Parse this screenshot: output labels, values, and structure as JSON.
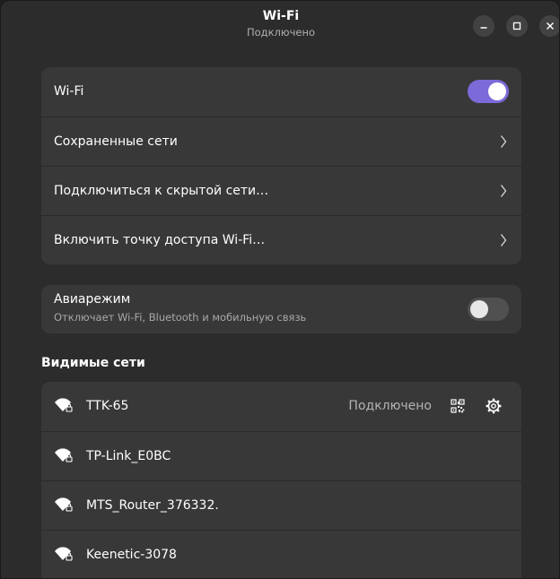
{
  "header": {
    "title": "Wi-Fi",
    "subtitle": "Подключено"
  },
  "wifi_card": {
    "wifi_label": "Wi-Fi",
    "wifi_enabled": true,
    "saved_networks": "Сохраненные сети",
    "hidden_network": "Подключиться к скрытой сети…",
    "hotspot": "Включить точку доступа Wi-Fi…"
  },
  "airplane": {
    "title": "Авиарежим",
    "subtitle": "Отключает Wi-Fi, Bluetooth и мобильную связь",
    "enabled": false
  },
  "visible_networks": {
    "heading": "Видимые сети",
    "networks": [
      {
        "name": "TTK-65",
        "status": "Подключено",
        "secured": true
      },
      {
        "name": "TP-Link_E0BC",
        "secured": true
      },
      {
        "name": "MTS_Router_376332.",
        "secured": true
      },
      {
        "name": "Keenetic-3078",
        "secured": true
      }
    ]
  },
  "colors": {
    "accent": "#7b6ad8",
    "window_bg": "#2c2c2c",
    "card_bg": "#383838"
  }
}
